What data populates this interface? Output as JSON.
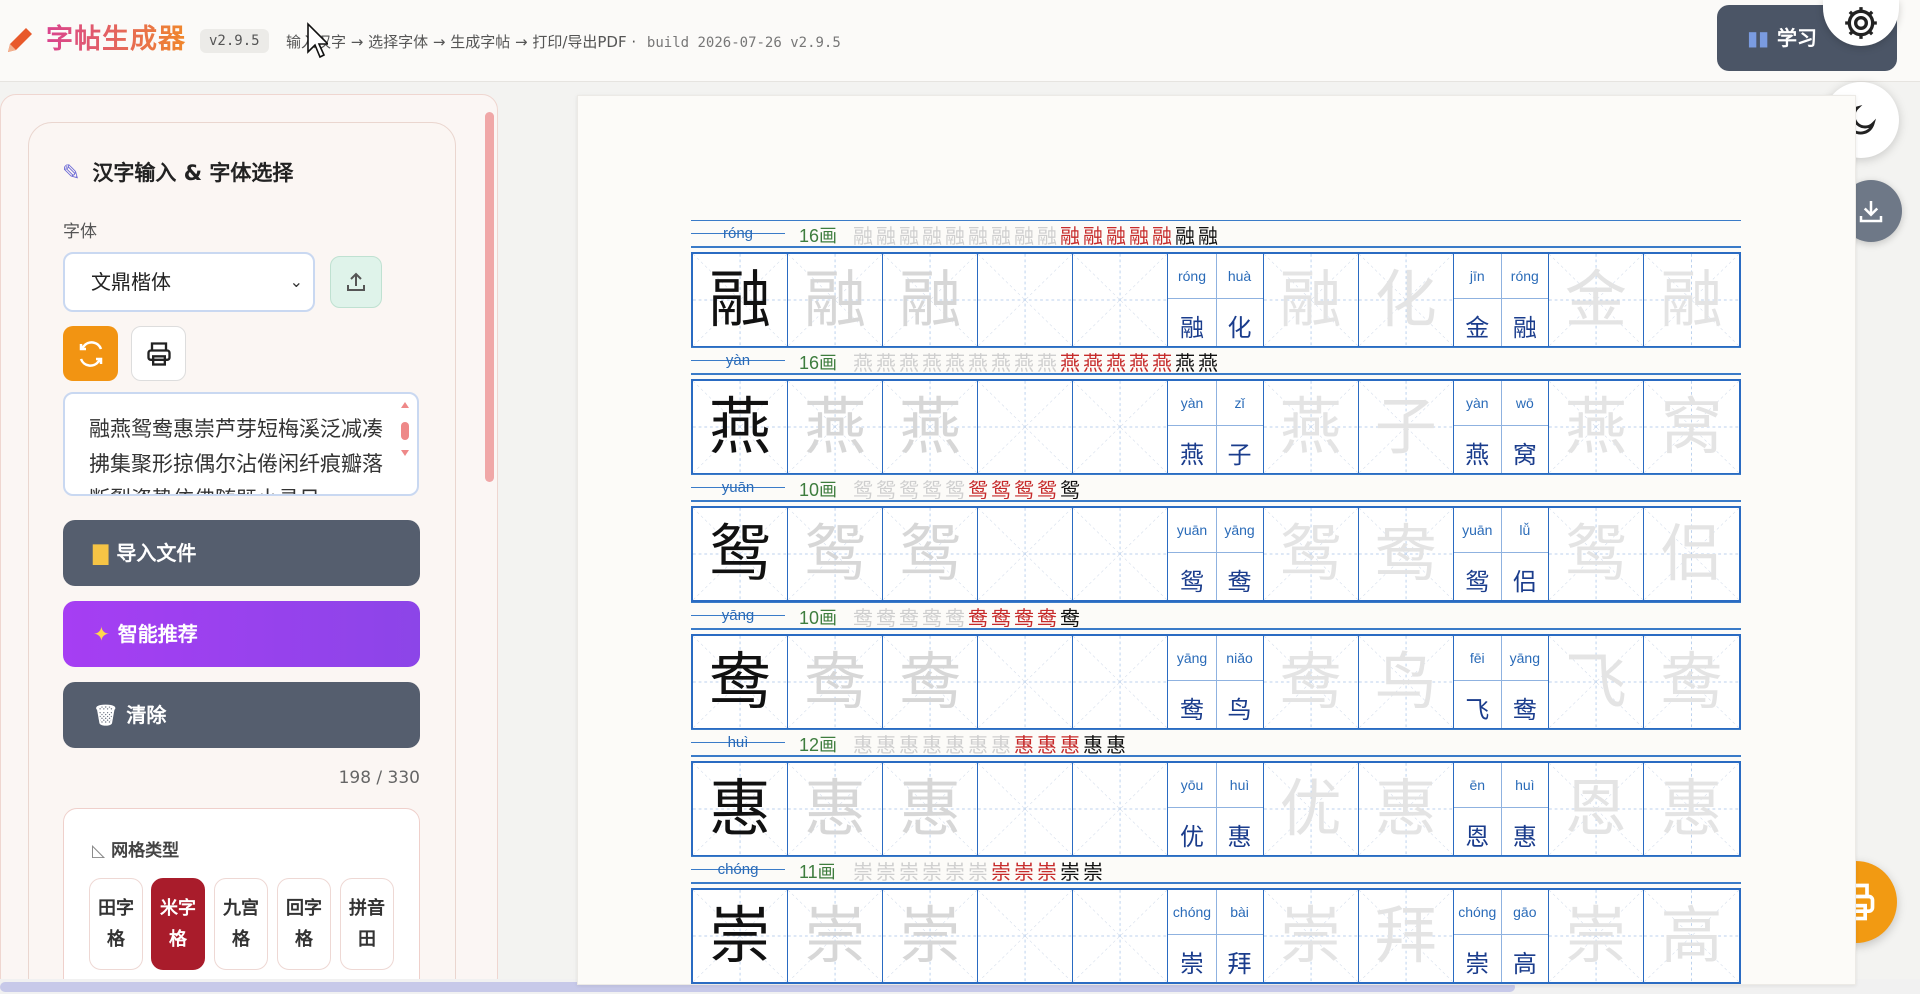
{
  "header": {
    "logo_icon": "pencil-icon",
    "title": "字帖生成器",
    "version": "v2.9.5",
    "steps": "输入汉字 → 选择字体 → 生成字帖 → 打印/导出PDF  ·",
    "build": "build 2026-07-26 v2.9.5",
    "study_button": "学习",
    "study_icon": "chart-icon"
  },
  "input_panel": {
    "title": "汉字输入 & 字体选择",
    "title_icon": "pen-icon",
    "font_label": "字体",
    "font_selected": "文鼎楷体",
    "text": "融燕鸳鸯惠崇芦芽短梅溪泛减凑拂集聚形掠偶尔沾倦闲纤痕瓣落断裂瓷势依佛随既小寻日",
    "import_button": "导入文件",
    "smart_button": "智能推荐",
    "clear_button": "清除",
    "char_count": "198 / 330"
  },
  "grid_types": {
    "title": "网格类型",
    "options": [
      {
        "label": "田字格",
        "l1": "田字",
        "l2": "格",
        "active": false
      },
      {
        "label": "米字格",
        "l1": "米字",
        "l2": "格",
        "active": true
      },
      {
        "label": "九宫格",
        "l1": "九宫",
        "l2": "格",
        "active": false
      },
      {
        "label": "回字格",
        "l1": "回字",
        "l2": "格",
        "active": false
      },
      {
        "label": "拼音田",
        "l1": "拼音",
        "l2": "田",
        "active": false
      }
    ]
  },
  "sheet": {
    "rows": [
      {
        "char": "融",
        "pinyin": "róng",
        "strokes": "16画",
        "order": "融融融融融融融融融融融融融融融融",
        "words": [
          {
            "chars": [
              "融",
              "化"
            ],
            "pinyin": [
              "róng",
              "huà"
            ]
          },
          {
            "chars": [
              "金",
              "融"
            ],
            "pinyin": [
              "jīn",
              "róng"
            ]
          }
        ]
      },
      {
        "char": "燕",
        "pinyin": "yàn",
        "strokes": "16画",
        "order": "燕燕燕燕燕燕燕燕燕燕燕燕燕燕燕燕",
        "words": [
          {
            "chars": [
              "燕",
              "子"
            ],
            "pinyin": [
              "yàn",
              "zǐ"
            ]
          },
          {
            "chars": [
              "燕",
              "窝"
            ],
            "pinyin": [
              "yàn",
              "wō"
            ]
          }
        ]
      },
      {
        "char": "鸳",
        "pinyin": "yuān",
        "strokes": "10画",
        "order": "鸳鸳鸳鸳鸳鸳鸳鸳鸳鸳",
        "words": [
          {
            "chars": [
              "鸳",
              "鸯"
            ],
            "pinyin": [
              "yuān",
              "yāng"
            ]
          },
          {
            "chars": [
              "鸳",
              "侣"
            ],
            "pinyin": [
              "yuān",
              "lǚ"
            ]
          }
        ]
      },
      {
        "char": "鸯",
        "pinyin": "yāng",
        "strokes": "10画",
        "order": "鸯鸯鸯鸯鸯鸯鸯鸯鸯鸯",
        "words": [
          {
            "chars": [
              "鸯",
              "鸟"
            ],
            "pinyin": [
              "yāng",
              "niǎo"
            ]
          },
          {
            "chars": [
              "飞",
              "鸯"
            ],
            "pinyin": [
              "fēi",
              "yāng"
            ]
          }
        ]
      },
      {
        "char": "惠",
        "pinyin": "huì",
        "strokes": "12画",
        "order": "惠惠惠惠惠惠惠惠惠惠惠惠",
        "words": [
          {
            "chars": [
              "优",
              "惠"
            ],
            "pinyin": [
              "yōu",
              "huì"
            ]
          },
          {
            "chars": [
              "恩",
              "惠"
            ],
            "pinyin": [
              "ēn",
              "huì"
            ]
          }
        ]
      },
      {
        "char": "崇",
        "pinyin": "chóng",
        "strokes": "11画",
        "order": "崇崇崇崇崇崇崇崇崇崇崇",
        "words": [
          {
            "chars": [
              "崇",
              "拜"
            ],
            "pinyin": [
              "chóng",
              "bài"
            ]
          },
          {
            "chars": [
              "崇",
              "高"
            ],
            "pinyin": [
              "chóng",
              "gāo"
            ]
          }
        ]
      }
    ]
  }
}
